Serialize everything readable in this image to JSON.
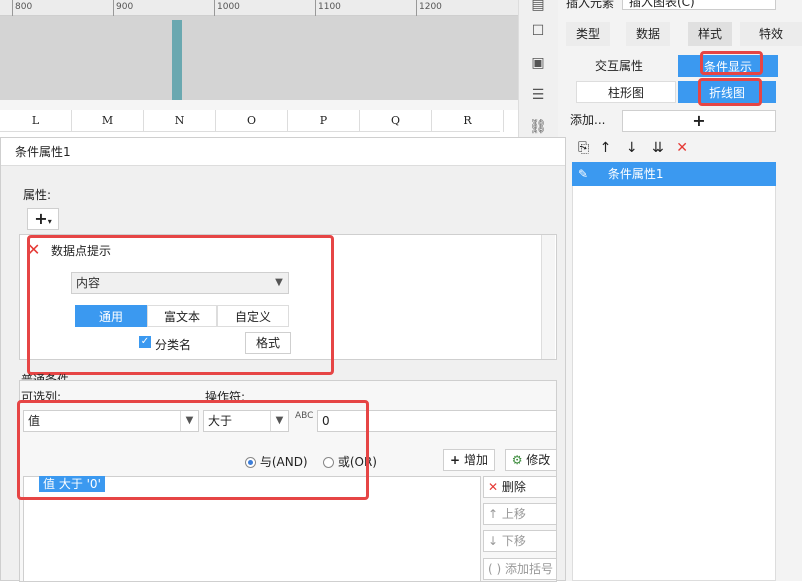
{
  "ruler": {
    "ticks": [
      "800",
      "900",
      "1000",
      "1100",
      "1200"
    ]
  },
  "columns": [
    "L",
    "M",
    "N",
    "O",
    "P",
    "Q",
    "R"
  ],
  "top_right": {
    "insert_element": "插入元素",
    "insert_chart": "插入图表(C)"
  },
  "tabs": [
    "类型",
    "数据",
    "样式",
    "特效"
  ],
  "panel": {
    "interaction": "交互属性",
    "condition_display": "条件显示",
    "bar_chart": "柱形图",
    "line_chart": "折线图",
    "add_label": "添加...",
    "condition_item": "条件属性1"
  },
  "dialog": {
    "title": "条件属性1",
    "attr_section": "属性:",
    "datapoint_label": "数据点提示",
    "content_select": "内容",
    "seg_tabs": [
      "通用",
      "富文本",
      "自定义"
    ],
    "category_name": "分类名",
    "format_btn": "格式",
    "normal_condition": "普通条件",
    "optional_col": "可选列:",
    "operator": "操作符:",
    "col_value": "值",
    "op_value": "大于",
    "cond_input": "0",
    "radio_and": "与(AND)",
    "radio_or": "或(OR)",
    "add_btn": "增加",
    "modify_btn": "修改",
    "condition_expr": "值 大于 '0'",
    "delete_btn": "删除",
    "move_up": "上移",
    "move_down": "下移",
    "add_bracket": "添加括号"
  },
  "colors": {
    "accent": "#3b99f0",
    "highlight": "#e64545"
  }
}
